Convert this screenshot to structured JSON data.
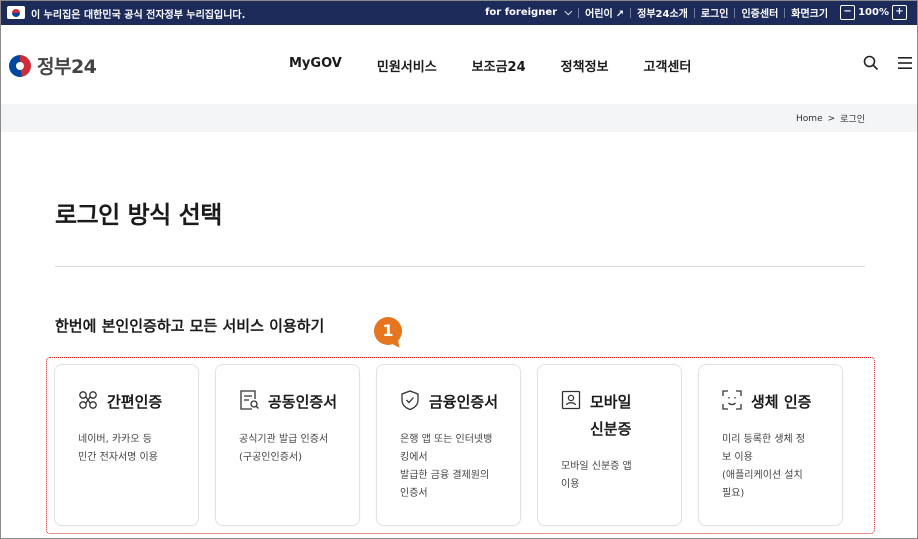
{
  "topbar": {
    "notice": "이 누리집은 대한민국 공식 전자정부 누리집입니다.",
    "links": [
      "for foreigner",
      "어린이",
      "정부24소개",
      "로그인",
      "인증센터",
      "화면크기"
    ],
    "zoom_minus": "−",
    "zoom_level": "100%",
    "zoom_plus": "+"
  },
  "header": {
    "logo_text": "정부24",
    "nav": [
      "MyGOV",
      "민원서비스",
      "보조금24",
      "정책정보",
      "고객센터"
    ]
  },
  "breadcrumb": {
    "home": "Home",
    "separator": ">",
    "current": "로그인"
  },
  "page": {
    "title": "로그인 방식 선택",
    "section_title": "한번에 본인인증하고 모든 서비스 이용하기",
    "callout_number": "1"
  },
  "methods": [
    {
      "icon": "simple-auth-icon",
      "name": "간편인증",
      "desc": "네이버, 카카오 등\n민간 전자서명 이용"
    },
    {
      "icon": "certificate-doc-icon",
      "name": "공동인증서",
      "desc": "공식기관 발급 인증서\n(구공인인증서)"
    },
    {
      "icon": "shield-check-icon",
      "name": "금융인증서",
      "desc": "은행 앱 또는 인터넷뱅\n킹에서\n발급한 금융 결제원의\n인증서"
    },
    {
      "icon": "mobile-id-icon",
      "name": "모바일\n신분증",
      "desc": "모바일 신분증 앱\n이용"
    },
    {
      "icon": "face-scan-icon",
      "name": "생체 인증",
      "desc": "미리 등록한 생체 정\n보 이용\n(애플리케이션 설치\n필요)"
    }
  ],
  "colors": {
    "topbar": "#1c2b5a",
    "callout": "#e5761f",
    "highlight_border": "#d1191c"
  }
}
